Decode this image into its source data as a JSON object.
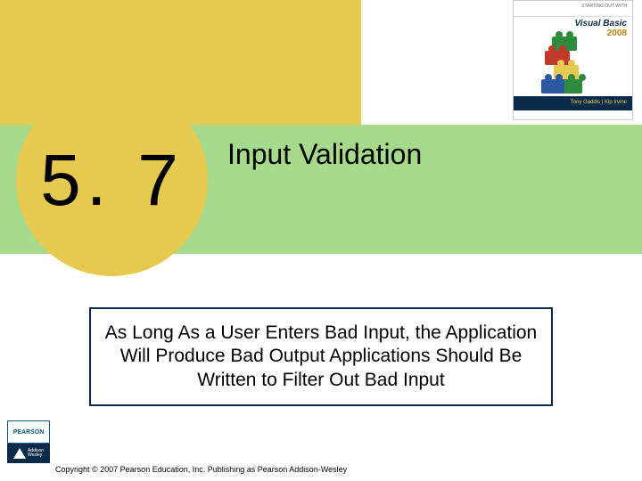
{
  "book": {
    "starting_text": "STARTING OUT WITH",
    "title": "Visual Basic",
    "year": "2008",
    "authors": "Tony Gaddis | Kip Irvine"
  },
  "section": {
    "number": "5. 7",
    "title": "Input Validation"
  },
  "body": {
    "text": "As Long As a User Enters Bad Input, the Application Will Produce Bad Output Applications Should Be Written to Filter Out Bad Input"
  },
  "publisher": {
    "pearson": "PEARSON",
    "imprint_line1": "Addison",
    "imprint_line2": "Wesley"
  },
  "footer": {
    "copyright": "Copyright © 2007 Pearson Education, Inc. Publishing as Pearson Addison-Wesley"
  }
}
